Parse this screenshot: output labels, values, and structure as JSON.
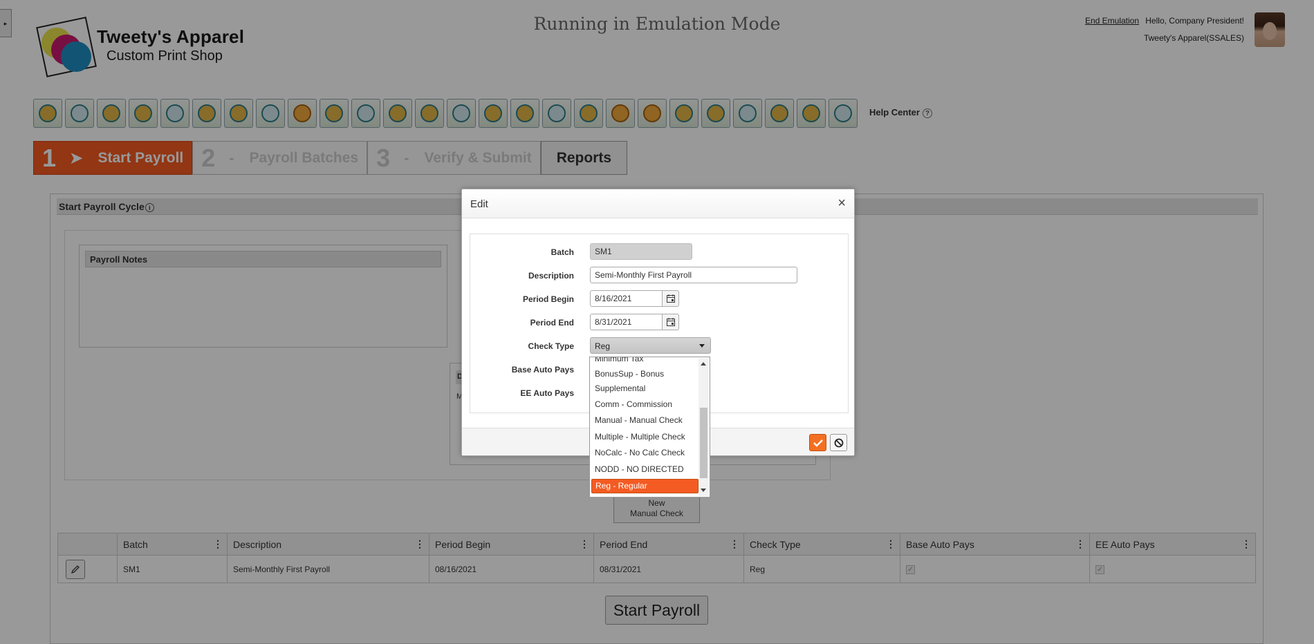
{
  "header": {
    "brand_line1": "Tweety's Apparel",
    "brand_line2": "Custom Print Shop",
    "emulation_title": "Running in Emulation Mode",
    "end_emulation": "End Emulation",
    "greeting": "Hello, Company President!",
    "company": "Tweety's Apparel(SSALES)"
  },
  "toolbar": {
    "icons": [
      "home-icon",
      "user-target-icon",
      "people-settings-icon",
      "board-icon",
      "group-icon",
      "team-icon",
      "org-chart-icon",
      "document-icon",
      "money-bag-icon",
      "target-icon",
      "target-icon",
      "target-icon",
      "target-icon",
      "tools-icon",
      "person-board-icon",
      "shield-icon",
      "search-doc-icon",
      "person-x-icon",
      "money-bag-icon",
      "group-money-icon",
      "person-arrow-icon",
      "group-network-icon",
      "search-doc-icon",
      "gift-icon",
      "group-board-icon",
      "settings-people-icon"
    ],
    "help_center": "Help Center",
    "help_q": "?"
  },
  "steps": [
    {
      "num": "1",
      "sep": "➤",
      "label": "Start Payroll"
    },
    {
      "num": "2",
      "sep": "-",
      "label": "Payroll Batches"
    },
    {
      "num": "3",
      "sep": "-",
      "label": "Verify & Submit"
    },
    {
      "label": "Reports"
    }
  ],
  "panel": {
    "title": "Start Payroll Cycle",
    "notes_title": "Payroll Notes",
    "mid_tag1": "D",
    "mid_tag2": "M",
    "new_manual_line1": "New",
    "new_manual_line2": "Manual Check",
    "start_button": "Start Payroll"
  },
  "grid": {
    "columns": [
      "",
      "Batch",
      "Description",
      "Period Begin",
      "Period End",
      "Check Type",
      "Base Auto Pays",
      "EE Auto Pays"
    ],
    "row": {
      "batch": "SM1",
      "description": "Semi-Monthly First Payroll",
      "period_begin": "08/16/2021",
      "period_end": "08/31/2021",
      "check_type": "Reg"
    }
  },
  "modal": {
    "title": "Edit",
    "close": "×",
    "fields": {
      "batch_label": "Batch",
      "batch_value": "SM1",
      "description_label": "Description",
      "description_value": "Semi-Monthly First Payroll",
      "period_begin_label": "Period Begin",
      "period_begin_value": "8/16/2021",
      "period_end_label": "Period End",
      "period_end_value": "8/31/2021",
      "check_type_label": "Check Type",
      "check_type_value": "Reg",
      "base_auto_label": "Base Auto Pays",
      "ee_auto_label": "EE Auto Pays"
    }
  },
  "dropdown": {
    "options": [
      "Minimum Tax",
      "BonusSup - Bonus",
      "Supplemental",
      "Comm - Commission",
      "Manual - Manual Check",
      "Multiple - Multiple Check",
      "NoCalc - No Calc Check",
      "NODD - NO DIRECTED",
      "Reg - Regular"
    ],
    "selected": "Reg - Regular"
  },
  "colors": {
    "accent": "#f45b22",
    "overlay": "rgba(0,0,0,0.4)"
  }
}
